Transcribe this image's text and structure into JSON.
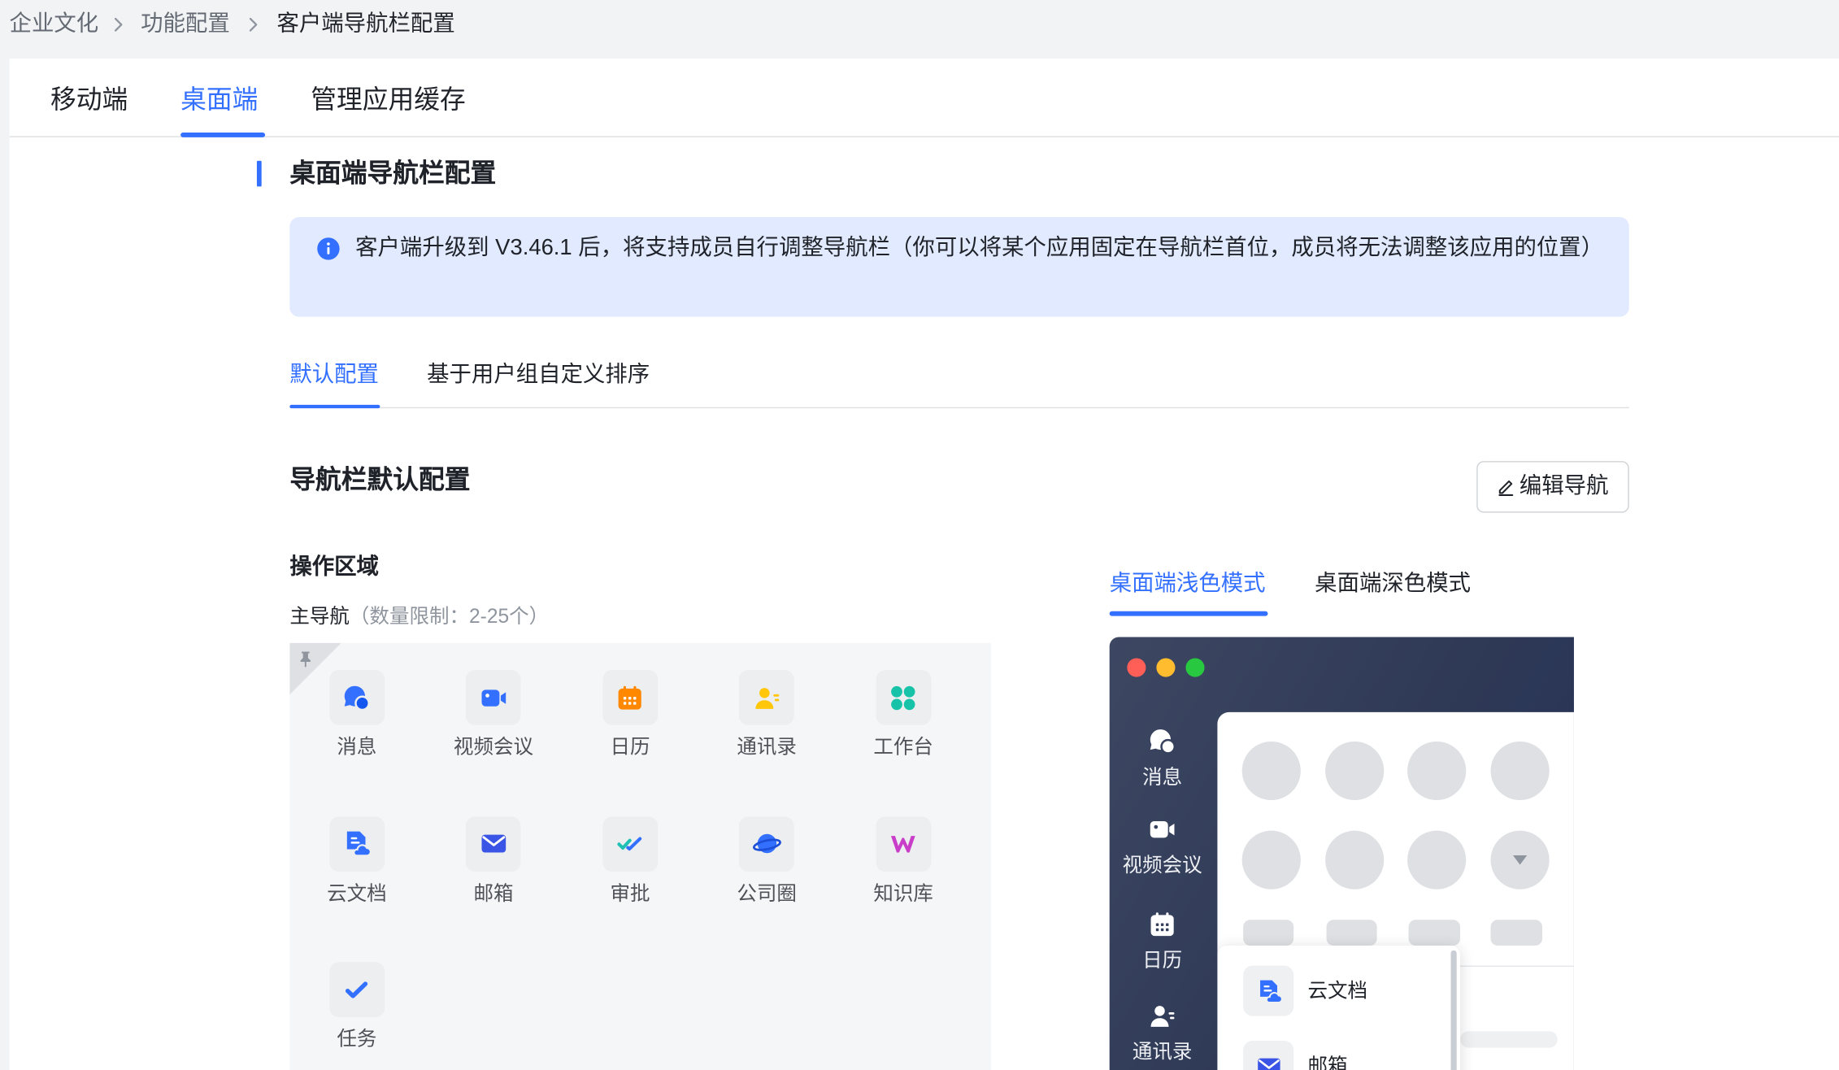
{
  "breadcrumb": {
    "items": [
      {
        "label": "企业文化"
      },
      {
        "label": "功能配置"
      },
      {
        "label": "客户端导航栏配置"
      }
    ],
    "separator_icon": "chevron-right-icon"
  },
  "top_tabs": [
    {
      "label": "移动端",
      "active": false
    },
    {
      "label": "桌面端",
      "active": true
    },
    {
      "label": "管理应用缓存",
      "active": false
    }
  ],
  "section": {
    "title": "桌面端导航栏配置"
  },
  "notice": {
    "icon": "info-icon",
    "text": "客户端升级到 V3.46.1 后，将支持成员自行调整导航栏（你可以将某个应用固定在导航栏首位，成员将无法调整该应用的位置）"
  },
  "sub_tabs": [
    {
      "label": "默认配置",
      "active": true
    },
    {
      "label": "基于用户组自定义排序",
      "active": false
    }
  ],
  "nav_config": {
    "title": "导航栏默认配置",
    "edit_button": "编辑导航",
    "edit_icon": "pencil-icon"
  },
  "operation_area": {
    "title": "操作区域",
    "main_nav": {
      "label": "主导航",
      "limit": "（数量限制：2-25个）",
      "pinned_icon": "pin-icon"
    },
    "apps": [
      {
        "label": "消息",
        "icon": "message-icon"
      },
      {
        "label": "视频会议",
        "icon": "video-meeting-icon"
      },
      {
        "label": "日历",
        "icon": "calendar-icon"
      },
      {
        "label": "通讯录",
        "icon": "contacts-icon"
      },
      {
        "label": "工作台",
        "icon": "workplace-icon"
      },
      {
        "label": "云文档",
        "icon": "cloud-docs-icon"
      },
      {
        "label": "邮箱",
        "icon": "mail-icon"
      },
      {
        "label": "审批",
        "icon": "approval-icon"
      },
      {
        "label": "公司圈",
        "icon": "moments-icon"
      },
      {
        "label": "知识库",
        "icon": "wiki-icon"
      },
      {
        "label": "任务",
        "icon": "task-icon"
      }
    ]
  },
  "preview": {
    "tabs": [
      {
        "label": "桌面端浅色模式",
        "active": true
      },
      {
        "label": "桌面端深色模式",
        "active": false
      }
    ],
    "sidebar": [
      {
        "label": "消息",
        "icon": "message-icon"
      },
      {
        "label": "视频会议",
        "icon": "video-meeting-icon"
      },
      {
        "label": "日历",
        "icon": "calendar-icon"
      },
      {
        "label": "通讯录",
        "icon": "contacts-icon"
      }
    ],
    "more_menu": [
      {
        "label": "云文档",
        "icon": "cloud-docs-icon"
      },
      {
        "label": "邮箱",
        "icon": "mail-icon"
      }
    ],
    "expand_icon": "caret-down-icon"
  },
  "colors": {
    "accent": "#3370ff",
    "notice_bg": "#e1eaff",
    "text_primary": "#1f2329",
    "text_secondary": "#646a73",
    "text_tertiary": "#8f959e",
    "preview_bg": "#2e3956",
    "calendar_orange": "#ff8800",
    "contacts_yellow": "#ffc60a",
    "workplace_teal": "#17c3a8",
    "wiki_magenta": "#c93ec8"
  }
}
